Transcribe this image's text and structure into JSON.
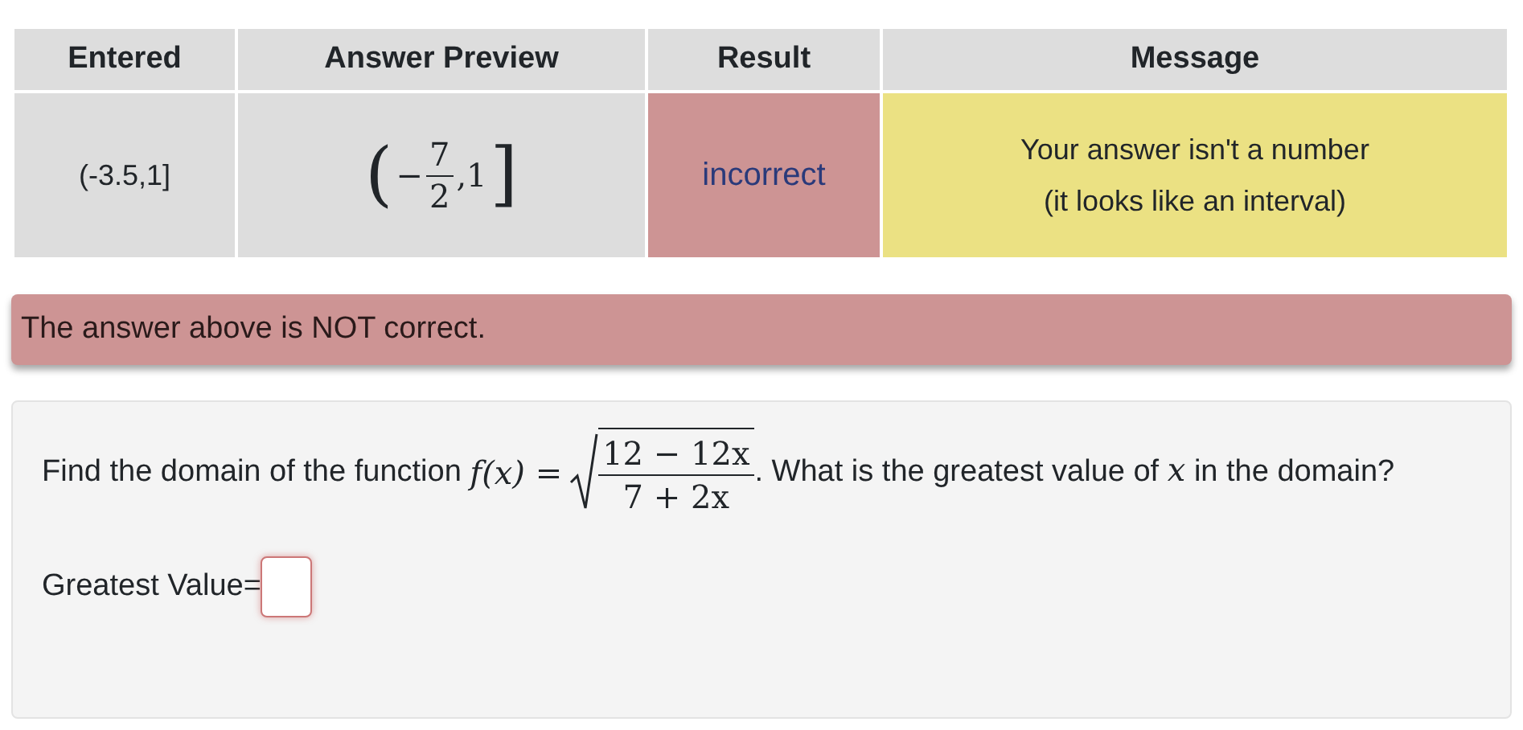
{
  "results_table": {
    "columns": [
      "Entered",
      "Answer Preview",
      "Result",
      "Message"
    ],
    "rows": [
      {
        "entered": "(-3.5,1]",
        "preview": {
          "open": "(",
          "sign": "−",
          "numerator": "7",
          "denominator": "2",
          "rest": ",1",
          "close": "]"
        },
        "result": "incorrect",
        "correct": false,
        "message": [
          "Your answer isn't a number",
          "(it looks like an interval)"
        ]
      }
    ]
  },
  "alert": {
    "text": "The answer above is NOT correct.",
    "correct": false
  },
  "problem": {
    "prefix": "Find the domain of the function",
    "function": "f(x) =",
    "numerator": "12 − 12x",
    "denominator": "7 + 2x",
    "middle": ". What is the greatest value of",
    "variable": "x",
    "suffix": "in the domain?",
    "answer_label": "Greatest Value="
  }
}
